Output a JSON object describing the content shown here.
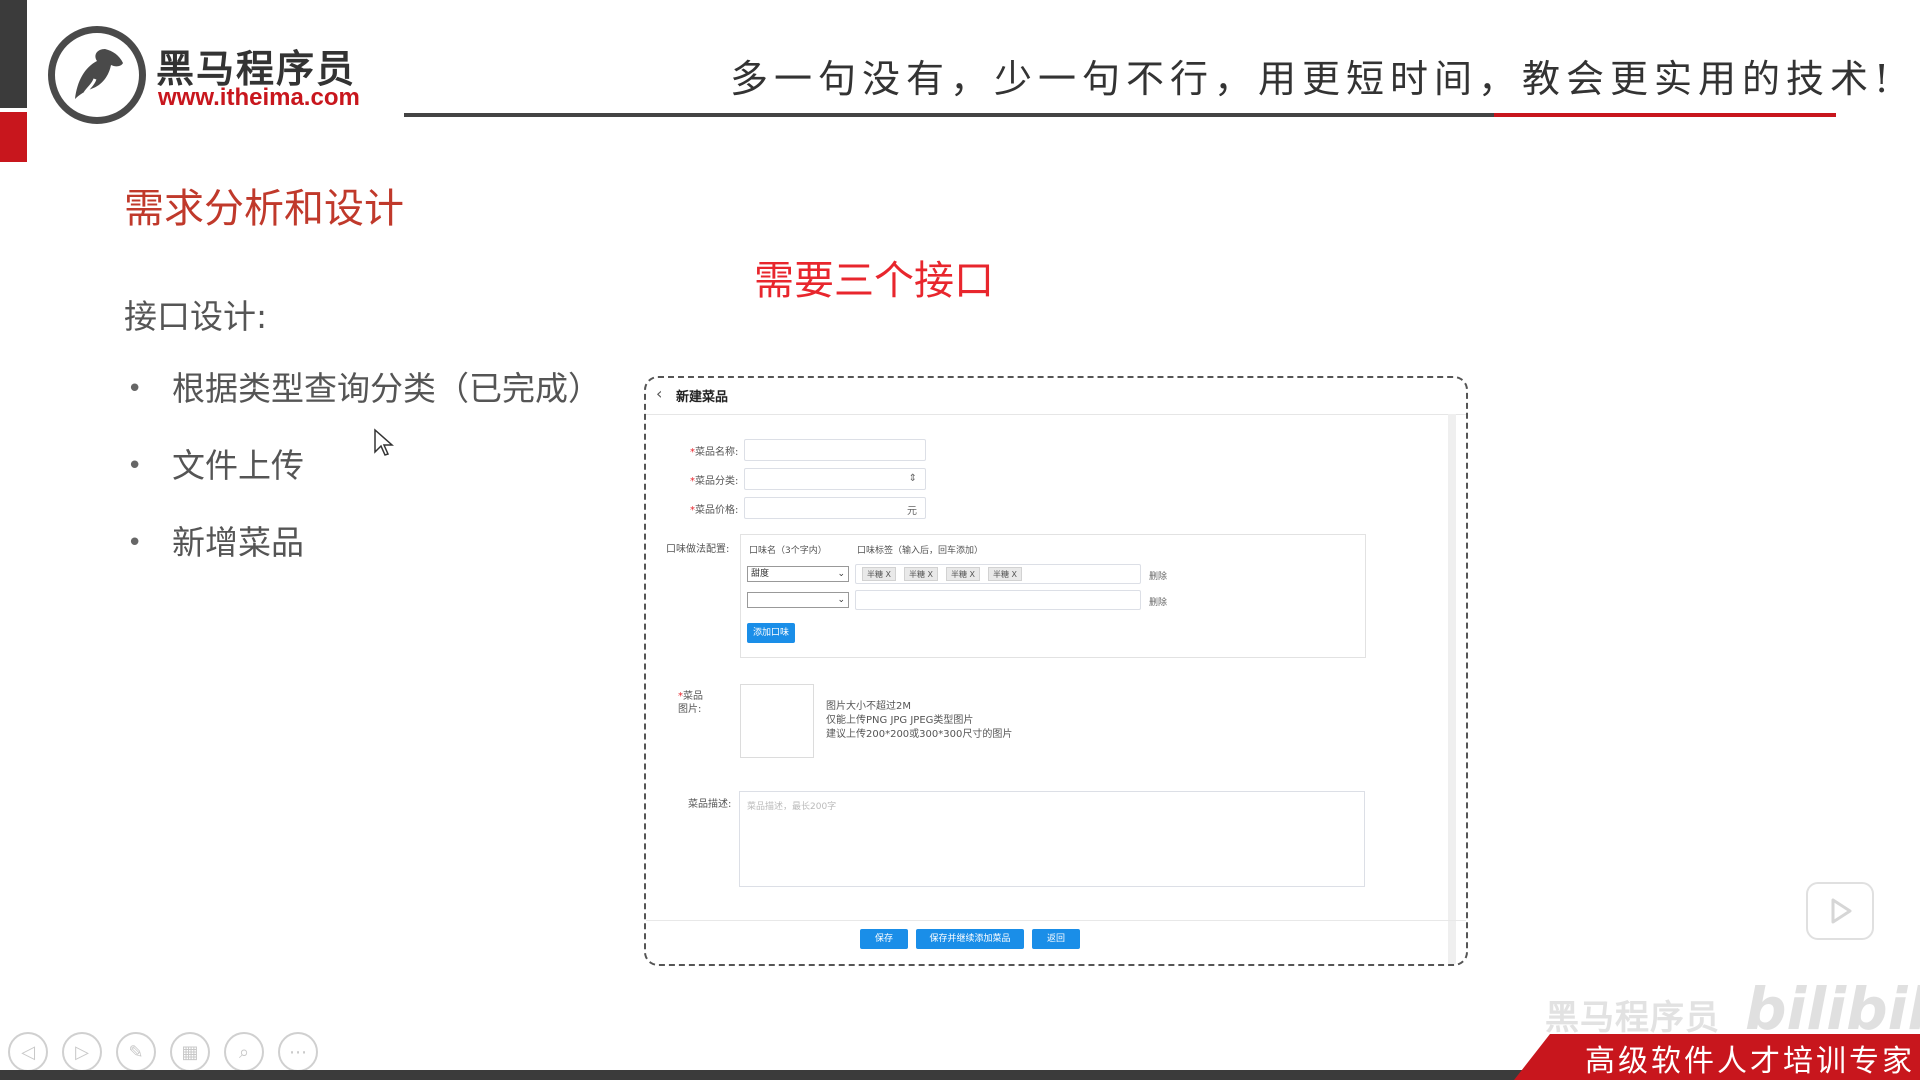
{
  "header": {
    "logo_cn": "黑马程序员",
    "logo_url": "www.itheima.com",
    "slogan": "多一句没有，少一句不行，用更短时间，教会更实用的技术!"
  },
  "slide": {
    "title": "需求分析和设计",
    "note": "需要三个接口",
    "api_label": "接口设计:",
    "bullets": [
      {
        "text": "根据类型查询分类（已完成）"
      },
      {
        "text": "文件上传"
      },
      {
        "text": "新增菜品"
      }
    ]
  },
  "form": {
    "title": "新建菜品",
    "fields": {
      "name_label": "菜品名称:",
      "category_label": "菜品分类:",
      "price_label": "菜品价格:",
      "price_suffix": "元",
      "flavor_label": "口味做法配置:",
      "image_label": "菜品图片:",
      "desc_label": "菜品描述:",
      "desc_placeholder": "菜品描述，最长200字"
    },
    "flavor": {
      "col_name": "口味名（3个字内）",
      "col_tags": "口味标签（输入后，回车添加）",
      "row1_name": "甜度",
      "row1_tags": [
        "半糖 X",
        "半糖 X",
        "半糖 X",
        "半糖 X"
      ],
      "delete_label": "删除",
      "add_button": "添加口味"
    },
    "image_hints": [
      "图片大小不超过2M",
      "仅能上传PNG JPG JPEG类型图片",
      "建议上传200*200或300*300尺寸的图片"
    ],
    "buttons": {
      "save": "保存",
      "save_continue": "保存并继续添加菜品",
      "back": "返回"
    }
  },
  "footer": {
    "banner": "高级软件人才培训专家",
    "watermark": "黑马程序员",
    "bili": "bilibili"
  },
  "colors": {
    "brand_red": "#c8161d",
    "note_red": "#e8262d",
    "button_blue": "#1a8ee8"
  }
}
